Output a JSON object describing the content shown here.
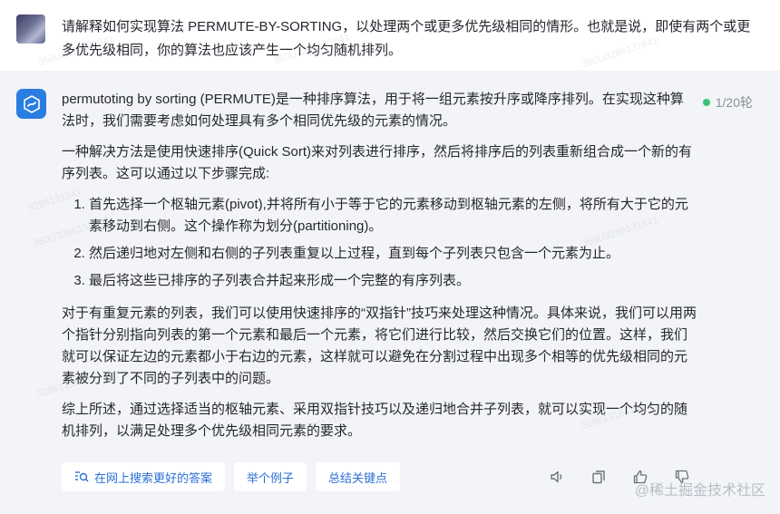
{
  "user_message": {
    "text": "请解释如何实现算法 PERMUTE-BY-SORTING，以处理两个或更多优先级相同的情形。也就是说，即使有两个或更多优先级相同，你的算法也应该产生一个均匀随机排列。"
  },
  "bot_message": {
    "paragraphs_before": [
      "permutoting by sorting (PERMUTE)是一种排序算法，用于将一组元素按升序或降序排列。在实现这种算法时，我们需要考虑如何处理具有多个相同优先级的元素的情况。",
      "一种解决方法是使用快速排序(Quick Sort)来对列表进行排序，然后将排序后的列表重新组合成一个新的有序列表。这可以通过以下步骤完成:"
    ],
    "steps": [
      "首先选择一个枢轴元素(pivot),并将所有小于等于它的元素移动到枢轴元素的左侧，将所有大于它的元素移动到右侧。这个操作称为划分(partitioning)。",
      "然后递归地对左侧和右侧的子列表重复以上过程，直到每个子列表只包含一个元素为止。",
      "最后将这些已排序的子列表合并起来形成一个完整的有序列表。"
    ],
    "paragraphs_after": [
      "对于有重复元素的列表，我们可以使用快速排序的“双指针”技巧来处理这种情况。具体来说，我们可以用两个指针分别指向列表的第一个元素和最后一个元素，将它们进行比较，然后交换它们的位置。这样，我们就可以保证左边的元素都小于右边的元素，这样就可以避免在分割过程中出现多个相等的优先级相同的元素被分到了不同的子列表中的问题。",
      "综上所述，通过选择适当的枢轴元素、采用双指针技巧以及递归地合并子列表，就可以实现一个均匀的随机排列，以满足处理多个优先级相同元素的要求。"
    ]
  },
  "turn_badge": "1/20轮",
  "actions": {
    "search": "在网上搜索更好的答案",
    "example": "举个例子",
    "summary": "总结关键点"
  },
  "watermark": {
    "corner": "@稀土掘金技术社区",
    "tiles": [
      "360U3286131641",
      "3286131641"
    ]
  },
  "colors": {
    "accent": "#2b6fd6",
    "status_dot": "#3cc27a",
    "bot_avatar": "#2a7de1"
  }
}
